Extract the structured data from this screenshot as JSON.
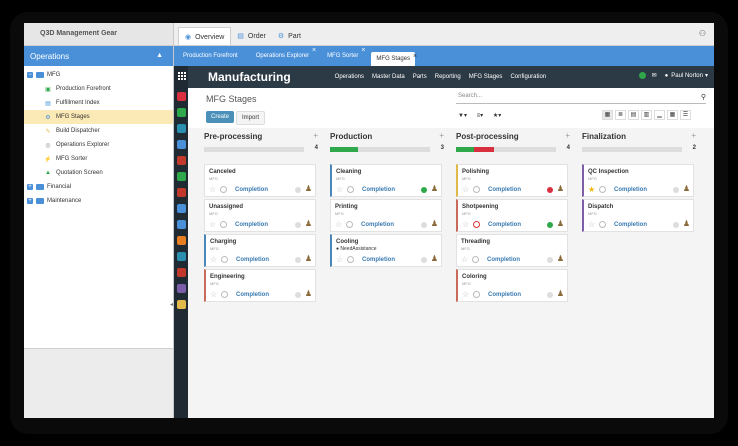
{
  "left": {
    "title": "Q3D Management Gear",
    "tab": "Operations",
    "items": [
      {
        "label": "MFG",
        "level": 0,
        "kind": "folder-open"
      },
      {
        "label": "Production Forefront",
        "level": 2,
        "icon": "▣"
      },
      {
        "label": "Fulfillment Index",
        "level": 2,
        "icon": "▤"
      },
      {
        "label": "MFG Stages",
        "level": 2,
        "icon": "⚙",
        "selected": true
      },
      {
        "label": "Build Dispatcher",
        "level": 2,
        "icon": "✎"
      },
      {
        "label": "Operations Explorer",
        "level": 2,
        "icon": "◎"
      },
      {
        "label": "MFG Sorter",
        "level": 2,
        "icon": "⚡"
      },
      {
        "label": "Quotation Screen",
        "level": 2,
        "icon": "▲"
      },
      {
        "label": "Financial",
        "level": 0,
        "kind": "folder"
      },
      {
        "label": "Maintenance",
        "level": 0,
        "kind": "folder"
      }
    ]
  },
  "doc_tabs": [
    {
      "label": "Overview",
      "active": true
    },
    {
      "label": "Order",
      "active": false
    },
    {
      "label": "Part",
      "active": false
    }
  ],
  "browser_tabs": [
    {
      "label": "Production Forefront",
      "closable": false,
      "active": false
    },
    {
      "label": "Operations Explorer",
      "closable": true,
      "active": false
    },
    {
      "label": "MFG Sorter",
      "closable": true,
      "active": false
    },
    {
      "label": "MFG Stages",
      "closable": true,
      "active": true
    }
  ],
  "app": {
    "title": "Manufacturing",
    "menu": [
      "Operations",
      "Master Data",
      "Parts",
      "Reporting",
      "MFG Stages",
      "Configuration"
    ],
    "user": "Paul Norton",
    "breadcrumb": "MFG Stages",
    "create_label": "Create",
    "import_label": "Import",
    "search_placeholder": "Search..."
  },
  "columns": [
    {
      "title": "Pre-processing",
      "count": "4",
      "progress": [],
      "cards": [
        {
          "title": "Canceled",
          "sub": "MFG",
          "link": "Completion",
          "state": "none",
          "border": ""
        },
        {
          "title": "Unassigned",
          "sub": "MFG",
          "link": "Completion",
          "state": "none",
          "border": ""
        },
        {
          "title": "Charging",
          "sub": "MFG",
          "link": "Completion",
          "state": "none",
          "border": "bl"
        },
        {
          "title": "Engineering",
          "sub": "MFG",
          "link": "Completion",
          "state": "none",
          "border": "br"
        }
      ]
    },
    {
      "title": "Production",
      "count": "3",
      "progress": [
        {
          "color": "#2ea84a",
          "pct": 0.28
        }
      ],
      "cards": [
        {
          "title": "Cleaning",
          "sub": "MFG",
          "link": "Completion",
          "state": "green",
          "border": "bl"
        },
        {
          "title": "Printing",
          "sub": "MFG",
          "link": "Completion",
          "state": "none",
          "border": ""
        },
        {
          "title": "Cooling",
          "sub": "",
          "tag": "● NeedAssistance",
          "link": "Completion",
          "state": "none",
          "border": "bl"
        }
      ]
    },
    {
      "title": "Post-processing",
      "count": "4",
      "progress": [
        {
          "color": "#2ea84a",
          "pct": 0.18
        },
        {
          "color": "#d9303f",
          "pct": 0.2
        }
      ],
      "cards": [
        {
          "title": "Polishing",
          "sub": "MFG",
          "link": "Completion",
          "state": "red",
          "border": "bg"
        },
        {
          "title": "Shotpeening",
          "sub": "MFG",
          "link": "Completion",
          "state": "green",
          "border": "br",
          "clock": "red"
        },
        {
          "title": "Threading",
          "sub": "MFG",
          "link": "Completion",
          "state": "none",
          "border": ""
        },
        {
          "title": "Coloring",
          "sub": "MFG",
          "link": "Completion",
          "state": "none",
          "border": "br"
        }
      ]
    },
    {
      "title": "Finalization",
      "count": "2",
      "progress": [],
      "cards": [
        {
          "title": "QC Inspection",
          "sub": "MFG",
          "link": "Completion",
          "state": "none",
          "border": "bp",
          "star": "gold"
        },
        {
          "title": "Dispatch",
          "sub": "MFG",
          "link": "Completion",
          "state": "none",
          "border": "bp"
        }
      ]
    }
  ],
  "rail_colors": [
    "#d9303f",
    "#2ea84a",
    "#2b8fb0",
    "#4a90d9",
    "#c0392b",
    "#2ea84a",
    "#c0392b",
    "#4a90d9",
    "#4a90d9",
    "#e67e22",
    "#2b8fb0",
    "#c0392b",
    "#7b5ea7",
    "#e1b94a"
  ]
}
